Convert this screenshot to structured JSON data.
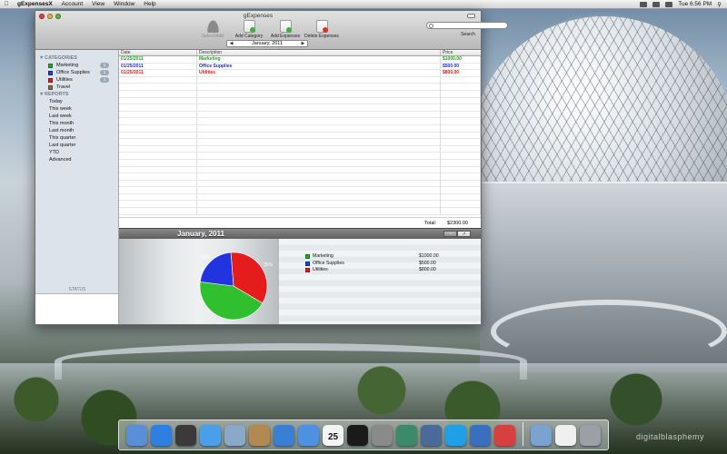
{
  "menubar": {
    "app_name": "gExpensesX",
    "menus": [
      "Account",
      "View",
      "Window",
      "Help"
    ],
    "clock": "Tue 6:56 PM"
  },
  "window": {
    "title": "gExpenses",
    "toolbar": {
      "items": [
        {
          "label": "Select/Add",
          "icon": "user-icon",
          "enabled": false
        },
        {
          "label": "Add Category",
          "icon": "add-category-icon",
          "enabled": true
        },
        {
          "label": "Add Expenses",
          "icon": "add-expense-icon",
          "enabled": true
        },
        {
          "label": "Delete Expenses",
          "icon": "delete-expense-icon",
          "enabled": true
        }
      ],
      "search_label": "Search"
    },
    "month_nav": {
      "current": "January,  2011"
    }
  },
  "sidebar": {
    "categories_header": "CATEGORIES",
    "categories": [
      {
        "name": "Marketing",
        "color": "#2aa52a",
        "count": "1"
      },
      {
        "name": "Office Supplies",
        "color": "#1f3fd6",
        "count": "1"
      },
      {
        "name": "Utilities",
        "color": "#d62020",
        "count": "1"
      },
      {
        "name": "Travel",
        "color": "#8b6a3a",
        "count": ""
      }
    ],
    "reports_header": "REPORTS",
    "reports": [
      "Today",
      "This week",
      "Last week",
      "This month",
      "Last month",
      "This quarter",
      "Last quarter",
      "YTD",
      "Advanced"
    ],
    "status_label": "STATUS"
  },
  "table": {
    "columns": [
      "Date",
      "Description",
      "Price"
    ],
    "rows": [
      {
        "date": "01/25/2011",
        "description": "Marketing",
        "price": "$1000.00",
        "color": "#1fa51f"
      },
      {
        "date": "01/25/2011",
        "description": "Office Supplies",
        "price": "$500.00",
        "color": "#1f2fd0"
      },
      {
        "date": "01/25/2011",
        "description": "Utilities",
        "price": "$800.00",
        "color": "#d61a1a"
      }
    ],
    "total_label": "Total:",
    "total_value": "$2300.00"
  },
  "chart_data": {
    "type": "pie",
    "title": "January,  2011",
    "slices": [
      {
        "name": "Marketing",
        "value": 1000,
        "label": "43%",
        "color": "#2fbf2f"
      },
      {
        "name": "Office Supplies",
        "value": 500,
        "label": "22%",
        "color": "#2233e0"
      },
      {
        "name": "Utilities",
        "value": 800,
        "label": "35%",
        "color": "#e41c1c"
      }
    ],
    "legend": [
      {
        "name": "Marketing",
        "value": "$1000.00",
        "color": "#2aa52a"
      },
      {
        "name": "Office Supplies",
        "value": "$500.00",
        "color": "#1f3fd6"
      },
      {
        "name": "Utilities",
        "value": "$800.00",
        "color": "#d62020"
      }
    ]
  },
  "dock": {
    "apps": [
      {
        "icon": "finder-icon",
        "color": "#5a8fd8"
      },
      {
        "icon": "app-store-icon",
        "color": "#2f7fe0"
      },
      {
        "icon": "dashboard-icon",
        "color": "#3a3a3a"
      },
      {
        "icon": "safari-icon",
        "color": "#4aa0e8"
      },
      {
        "icon": "mail-icon",
        "color": "#8aa8c8"
      },
      {
        "icon": "address-book-icon",
        "color": "#b08a52"
      },
      {
        "icon": "itunes-icon",
        "color": "#3a7fd6"
      },
      {
        "icon": "ichat-icon",
        "color": "#4f90e0"
      },
      {
        "icon": "calendar-icon",
        "color": "#f4f4f4",
        "text": "25"
      },
      {
        "icon": "terminal-icon",
        "color": "#1a1a1a"
      },
      {
        "icon": "system-preferences-icon",
        "color": "#8a8a8a"
      },
      {
        "icon": "time-machine-icon",
        "color": "#3c8a6a"
      },
      {
        "icon": "iphoto-icon",
        "color": "#4a6a9a"
      },
      {
        "icon": "skype-icon",
        "color": "#1fa0e6"
      },
      {
        "icon": "xcode-icon",
        "color": "#3a6fc0"
      },
      {
        "icon": "gexpenses-icon",
        "color": "#d64040"
      }
    ],
    "others": [
      {
        "icon": "applications-folder-icon",
        "color": "#7aa3d0"
      },
      {
        "icon": "document-icon",
        "color": "#f0f0f0"
      },
      {
        "icon": "trash-icon",
        "color": "#9aa0a6"
      }
    ]
  },
  "wallpaper": {
    "watermark": "digitalblasphemy"
  }
}
